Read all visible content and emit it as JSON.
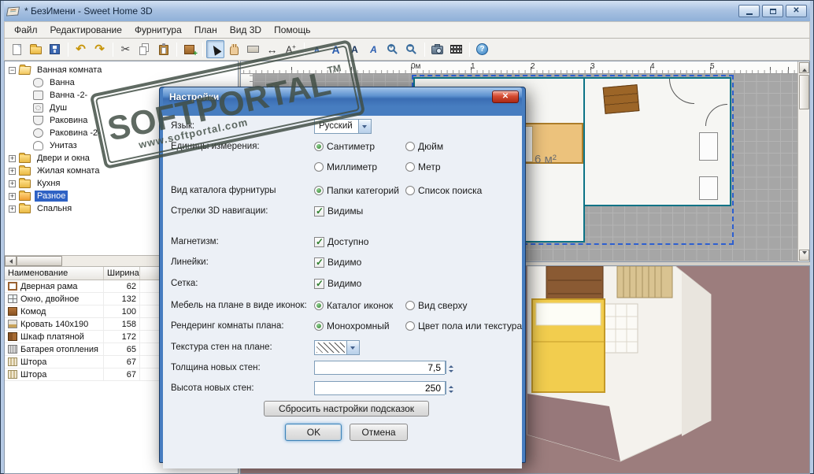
{
  "window": {
    "title": "* БезИмени - Sweet Home 3D"
  },
  "menu": {
    "items": [
      "Файл",
      "Редактирование",
      "Фурнитура",
      "План",
      "Вид 3D",
      "Помощь"
    ]
  },
  "toolbar": {
    "undo_glyph": "↶",
    "redo_glyph": "↷",
    "cut_glyph": "✂",
    "dims_glyph": "↔",
    "letter_a": "A",
    "help_glyph": "?"
  },
  "catalog": {
    "items": [
      {
        "label": "Ванная комната"
      },
      {
        "label": "Ванна"
      },
      {
        "label": "Ванна -2-"
      },
      {
        "label": "Душ"
      },
      {
        "label": "Раковина"
      },
      {
        "label": "Раковина -2-"
      },
      {
        "label": "Унитаз"
      },
      {
        "label": "Двери и окна"
      },
      {
        "label": "Жилая комната"
      },
      {
        "label": "Кухня"
      },
      {
        "label": "Разное"
      },
      {
        "label": "Спальня"
      }
    ]
  },
  "furniture_table": {
    "columns": [
      "Наименование",
      "Ширина"
    ],
    "rows": [
      {
        "name": "Дверная рама",
        "width": "62"
      },
      {
        "name": "Окно, двойное",
        "width": "132"
      },
      {
        "name": "Комод",
        "width": "100"
      },
      {
        "name": "Кровать 140x190",
        "width": "158"
      },
      {
        "name": "Шкаф платяной",
        "width": "172"
      },
      {
        "name": "Батарея отопления",
        "width": "65"
      },
      {
        "name": "Штора",
        "width": "67"
      },
      {
        "name": "Штора",
        "width": "67"
      }
    ]
  },
  "plan": {
    "ruler_labels": [
      "0м",
      "1",
      "2",
      "3",
      "4",
      "5"
    ],
    "area_label": "6 м²"
  },
  "dialog": {
    "title": "Настройки",
    "language": {
      "label": "Язык:",
      "value": "Русский"
    },
    "units": {
      "label": "Единицы измерения:",
      "options": [
        "Сантиметр",
        "Дюйм",
        "Миллиметр",
        "Метр"
      ]
    },
    "catalog_view": {
      "label": "Вид каталога фурнитуры",
      "options": [
        "Папки категорий",
        "Список поиска"
      ]
    },
    "nav_arrows": {
      "label": "Стрелки 3D навигации:",
      "option": "Видимы"
    },
    "magnetism": {
      "label": "Магнетизм:",
      "option": "Доступно"
    },
    "rulers": {
      "label": "Линейки:",
      "option": "Видимо"
    },
    "grid": {
      "label": "Сетка:",
      "option": "Видимо"
    },
    "furniture_icons": {
      "label": "Мебель на плане в виде иконок:",
      "options": [
        "Каталог иконок",
        "Вид сверху"
      ]
    },
    "room_rendering": {
      "label": "Рендеринг комнаты плана:",
      "options": [
        "Монохромный",
        "Цвет пола  или текстура"
      ]
    },
    "wall_texture": {
      "label": "Текстура стен на плане:"
    },
    "wall_thickness": {
      "label": "Толщина новых стен:",
      "value": "7,5"
    },
    "wall_height": {
      "label": "Высота новых стен:",
      "value": "250"
    },
    "reset_button": "Сбросить настройки подсказок",
    "ok_button": "OK",
    "cancel_button": "Отмена"
  },
  "watermark": {
    "name": "SOFTPORTAL",
    "tm": "TM",
    "url": "www.softportal.com"
  }
}
